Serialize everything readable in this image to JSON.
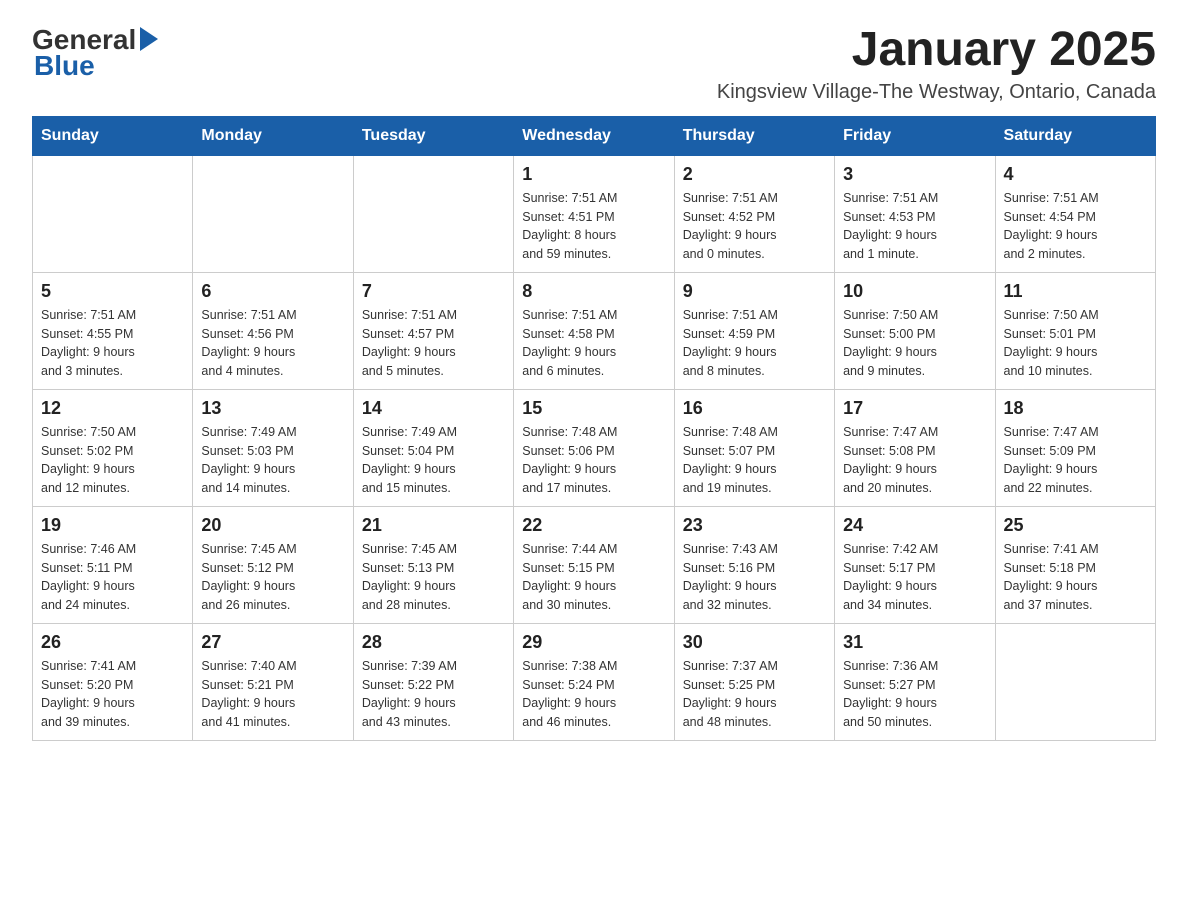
{
  "header": {
    "logo_general": "General",
    "logo_blue": "Blue",
    "month_title": "January 2025",
    "location": "Kingsview Village-The Westway, Ontario, Canada"
  },
  "weekdays": [
    "Sunday",
    "Monday",
    "Tuesday",
    "Wednesday",
    "Thursday",
    "Friday",
    "Saturday"
  ],
  "weeks": [
    [
      {
        "day": "",
        "info": ""
      },
      {
        "day": "",
        "info": ""
      },
      {
        "day": "",
        "info": ""
      },
      {
        "day": "1",
        "info": "Sunrise: 7:51 AM\nSunset: 4:51 PM\nDaylight: 8 hours\nand 59 minutes."
      },
      {
        "day": "2",
        "info": "Sunrise: 7:51 AM\nSunset: 4:52 PM\nDaylight: 9 hours\nand 0 minutes."
      },
      {
        "day": "3",
        "info": "Sunrise: 7:51 AM\nSunset: 4:53 PM\nDaylight: 9 hours\nand 1 minute."
      },
      {
        "day": "4",
        "info": "Sunrise: 7:51 AM\nSunset: 4:54 PM\nDaylight: 9 hours\nand 2 minutes."
      }
    ],
    [
      {
        "day": "5",
        "info": "Sunrise: 7:51 AM\nSunset: 4:55 PM\nDaylight: 9 hours\nand 3 minutes."
      },
      {
        "day": "6",
        "info": "Sunrise: 7:51 AM\nSunset: 4:56 PM\nDaylight: 9 hours\nand 4 minutes."
      },
      {
        "day": "7",
        "info": "Sunrise: 7:51 AM\nSunset: 4:57 PM\nDaylight: 9 hours\nand 5 minutes."
      },
      {
        "day": "8",
        "info": "Sunrise: 7:51 AM\nSunset: 4:58 PM\nDaylight: 9 hours\nand 6 minutes."
      },
      {
        "day": "9",
        "info": "Sunrise: 7:51 AM\nSunset: 4:59 PM\nDaylight: 9 hours\nand 8 minutes."
      },
      {
        "day": "10",
        "info": "Sunrise: 7:50 AM\nSunset: 5:00 PM\nDaylight: 9 hours\nand 9 minutes."
      },
      {
        "day": "11",
        "info": "Sunrise: 7:50 AM\nSunset: 5:01 PM\nDaylight: 9 hours\nand 10 minutes."
      }
    ],
    [
      {
        "day": "12",
        "info": "Sunrise: 7:50 AM\nSunset: 5:02 PM\nDaylight: 9 hours\nand 12 minutes."
      },
      {
        "day": "13",
        "info": "Sunrise: 7:49 AM\nSunset: 5:03 PM\nDaylight: 9 hours\nand 14 minutes."
      },
      {
        "day": "14",
        "info": "Sunrise: 7:49 AM\nSunset: 5:04 PM\nDaylight: 9 hours\nand 15 minutes."
      },
      {
        "day": "15",
        "info": "Sunrise: 7:48 AM\nSunset: 5:06 PM\nDaylight: 9 hours\nand 17 minutes."
      },
      {
        "day": "16",
        "info": "Sunrise: 7:48 AM\nSunset: 5:07 PM\nDaylight: 9 hours\nand 19 minutes."
      },
      {
        "day": "17",
        "info": "Sunrise: 7:47 AM\nSunset: 5:08 PM\nDaylight: 9 hours\nand 20 minutes."
      },
      {
        "day": "18",
        "info": "Sunrise: 7:47 AM\nSunset: 5:09 PM\nDaylight: 9 hours\nand 22 minutes."
      }
    ],
    [
      {
        "day": "19",
        "info": "Sunrise: 7:46 AM\nSunset: 5:11 PM\nDaylight: 9 hours\nand 24 minutes."
      },
      {
        "day": "20",
        "info": "Sunrise: 7:45 AM\nSunset: 5:12 PM\nDaylight: 9 hours\nand 26 minutes."
      },
      {
        "day": "21",
        "info": "Sunrise: 7:45 AM\nSunset: 5:13 PM\nDaylight: 9 hours\nand 28 minutes."
      },
      {
        "day": "22",
        "info": "Sunrise: 7:44 AM\nSunset: 5:15 PM\nDaylight: 9 hours\nand 30 minutes."
      },
      {
        "day": "23",
        "info": "Sunrise: 7:43 AM\nSunset: 5:16 PM\nDaylight: 9 hours\nand 32 minutes."
      },
      {
        "day": "24",
        "info": "Sunrise: 7:42 AM\nSunset: 5:17 PM\nDaylight: 9 hours\nand 34 minutes."
      },
      {
        "day": "25",
        "info": "Sunrise: 7:41 AM\nSunset: 5:18 PM\nDaylight: 9 hours\nand 37 minutes."
      }
    ],
    [
      {
        "day": "26",
        "info": "Sunrise: 7:41 AM\nSunset: 5:20 PM\nDaylight: 9 hours\nand 39 minutes."
      },
      {
        "day": "27",
        "info": "Sunrise: 7:40 AM\nSunset: 5:21 PM\nDaylight: 9 hours\nand 41 minutes."
      },
      {
        "day": "28",
        "info": "Sunrise: 7:39 AM\nSunset: 5:22 PM\nDaylight: 9 hours\nand 43 minutes."
      },
      {
        "day": "29",
        "info": "Sunrise: 7:38 AM\nSunset: 5:24 PM\nDaylight: 9 hours\nand 46 minutes."
      },
      {
        "day": "30",
        "info": "Sunrise: 7:37 AM\nSunset: 5:25 PM\nDaylight: 9 hours\nand 48 minutes."
      },
      {
        "day": "31",
        "info": "Sunrise: 7:36 AM\nSunset: 5:27 PM\nDaylight: 9 hours\nand 50 minutes."
      },
      {
        "day": "",
        "info": ""
      }
    ]
  ]
}
